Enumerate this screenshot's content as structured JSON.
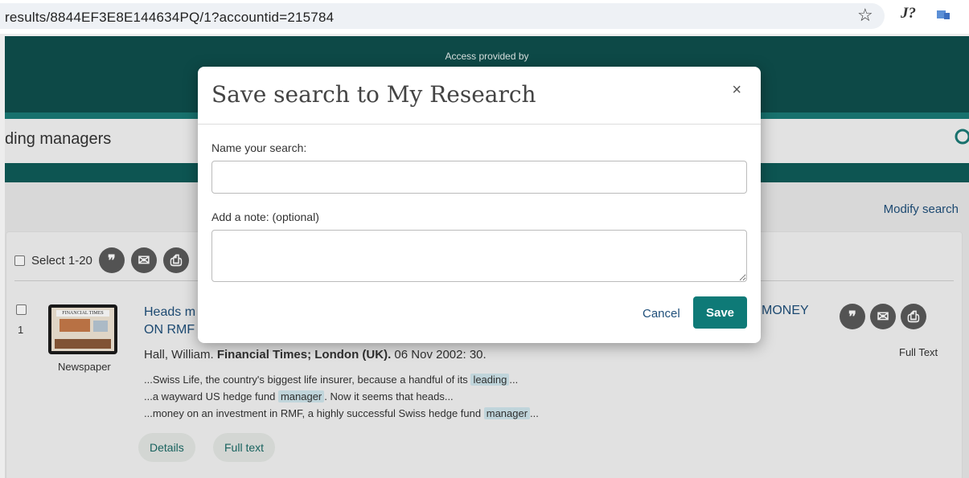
{
  "browser": {
    "url": "results/8844EF3E8E144634PQ/1?accountid=215784",
    "star_glyph": "☆",
    "ext_glyph": "J?"
  },
  "header": {
    "access_text": "Access provided by"
  },
  "search": {
    "term": "ding managers"
  },
  "toolbar": {
    "modify_search": "Modify search",
    "select_label": "Select 1-20"
  },
  "result": {
    "number": "1",
    "title": "Heads m",
    "title_line2": "ON RMF",
    "title_right": "MONEY",
    "author": "Hall, William.",
    "publication": "Financial Times; London (UK).",
    "date_page": "06 Nov 2002: 30.",
    "source_type": "Newspaper",
    "thumb_masthead": "FINANCIAL TIMES",
    "snippet1_pre": "...Swiss Life, the country's biggest life insurer, because a handful of its",
    "snippet1_hl": "leading",
    "snippet1_post": "...",
    "snippet2_pre": "...a wayward US hedge fund",
    "snippet2_hl": "manager",
    "snippet2_post": ". Now it seems that heads...",
    "snippet3_pre": "...money on an investment in RMF, a highly successful Swiss hedge fund",
    "snippet3_hl": "manager",
    "snippet3_post": "...",
    "details_label": "Details",
    "fulltext_pill": "Full text",
    "fulltext_label": "Full Text"
  },
  "modal": {
    "title": "Save search to My Research",
    "close_glyph": "×",
    "name_label": "Name your search:",
    "name_value": "",
    "note_label": "Add a note: (optional)",
    "note_value": "",
    "cancel_label": "Cancel",
    "save_label": "Save"
  },
  "colors": {
    "header_teal": "#0f4f4d",
    "accent_teal": "#0e7a77",
    "link_blue": "#1f4f7a",
    "highlight": "#cfe6ec"
  }
}
